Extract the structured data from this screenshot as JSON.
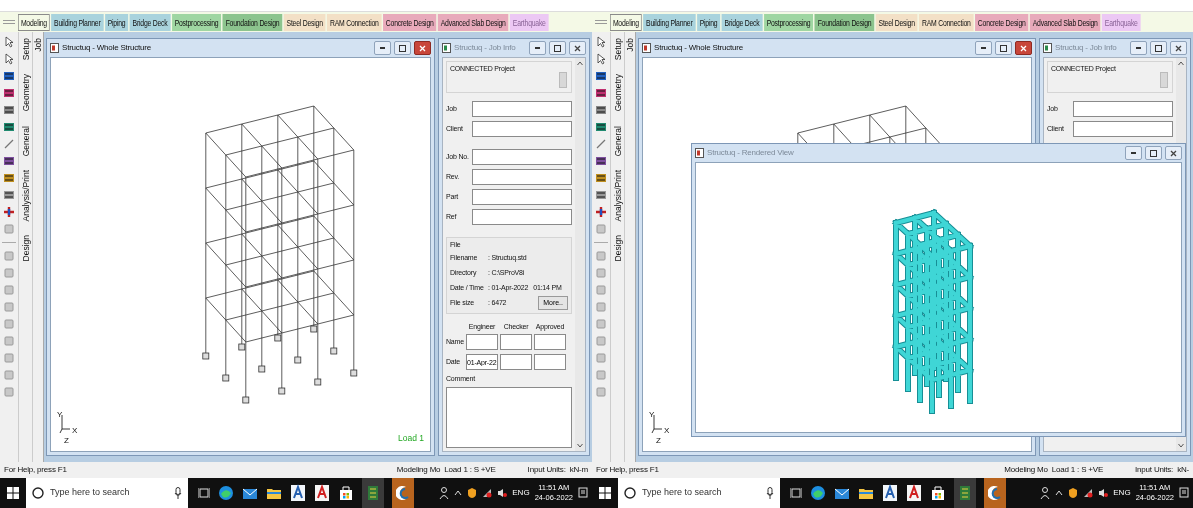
{
  "panes": [
    {
      "tabs": [
        {
          "label": "Modeling",
          "color": "#f4f9e6",
          "selected": true,
          "disabled": false
        },
        {
          "label": "Building Planner",
          "color": "#a9d3dd",
          "selected": false,
          "disabled": false
        },
        {
          "label": "Piping",
          "color": "#a9d3dd",
          "selected": false,
          "disabled": false
        },
        {
          "label": "Bridge Deck",
          "color": "#a9d3dd",
          "selected": false,
          "disabled": false
        },
        {
          "label": "Postprocessing",
          "color": "#9fd6a2",
          "selected": false,
          "disabled": false
        },
        {
          "label": "Foundation Design",
          "color": "#8cc48e",
          "selected": false,
          "disabled": false
        },
        {
          "label": "Steel Design",
          "color": "#f3e0c6",
          "selected": false,
          "disabled": false
        },
        {
          "label": "RAM Connection",
          "color": "#f3e0c6",
          "selected": false,
          "disabled": false
        },
        {
          "label": "Concrete Design",
          "color": "#e8aabb",
          "selected": false,
          "disabled": false
        },
        {
          "label": "Advanced Slab Design",
          "color": "#e8aabb",
          "selected": false,
          "disabled": false
        },
        {
          "label": "Earthquake",
          "color": "#ecc8f4",
          "selected": false,
          "disabled": true
        }
      ],
      "side_tabs": [
        "Setup",
        "Geometry",
        "General",
        "Analysis/Print",
        "Design"
      ],
      "job_tab": "Job",
      "structure_window": {
        "title": "Structuq - Whole Structure",
        "active": true,
        "load_label": "Load 1",
        "axes": [
          "Y",
          "X",
          "Z"
        ]
      },
      "job_info": {
        "title": "Structuq - Job Info",
        "active": false,
        "connected_label": "CONNECTED Project",
        "field_groups": [
          [
            {
              "label": "Job"
            },
            {
              "label": "Client"
            }
          ],
          [
            {
              "label": "Job No."
            },
            {
              "label": "Rev."
            },
            {
              "label": "Part"
            },
            {
              "label": "Ref"
            }
          ]
        ],
        "file": {
          "heading": "File",
          "rows": [
            {
              "label": "Filename",
              "value": ": Structuq.std"
            },
            {
              "label": "Directory",
              "value": ": C:\\SProV8i"
            },
            {
              "label": "Date / Time",
              "value": ": 01-Apr-2022",
              "extra": "01:14 PM"
            },
            {
              "label": "File size",
              "value": ": 6472"
            }
          ],
          "more_button": "More.."
        },
        "approvals": {
          "columns": [
            "Engineer",
            "Checker",
            "Approved"
          ],
          "rows": [
            {
              "label": "Name"
            },
            {
              "label": "Date",
              "values": [
                "01-Apr-22"
              ]
            }
          ]
        },
        "comment_label": "Comment"
      },
      "status_bar": {
        "help": "For Help, press F1",
        "mode": "Modeling Mo",
        "load": "Load 1 : S +VE",
        "units_label": "Input Units:",
        "units": "kN-m"
      },
      "taskbar": {
        "search_placeholder": "Type here to search",
        "language": "ENG",
        "time": "11:51 AM",
        "date": "24-06-2022"
      }
    },
    {
      "tabs": [
        {
          "label": "Modeling",
          "color": "#f4f9e6",
          "selected": true,
          "disabled": false
        },
        {
          "label": "Building Planner",
          "color": "#a9d3dd",
          "selected": false,
          "disabled": false
        },
        {
          "label": "Piping",
          "color": "#a9d3dd",
          "selected": false,
          "disabled": false
        },
        {
          "label": "Bridge Deck",
          "color": "#a9d3dd",
          "selected": false,
          "disabled": false
        },
        {
          "label": "Postprocessing",
          "color": "#9fd6a2",
          "selected": false,
          "disabled": false
        },
        {
          "label": "Foundation Design",
          "color": "#8cc48e",
          "selected": false,
          "disabled": false
        },
        {
          "label": "Steel Design",
          "color": "#f3e0c6",
          "selected": false,
          "disabled": false
        },
        {
          "label": "RAM Connection",
          "color": "#f3e0c6",
          "selected": false,
          "disabled": false
        },
        {
          "label": "Concrete Design",
          "color": "#e8aabb",
          "selected": false,
          "disabled": false
        },
        {
          "label": "Advanced Slab Design",
          "color": "#e8aabb",
          "selected": false,
          "disabled": false
        },
        {
          "label": "Earthquake",
          "color": "#ecc8f4",
          "selected": false,
          "disabled": true
        }
      ],
      "side_tabs": [
        "Setup",
        "Geometry",
        "General",
        "Analysis/Print",
        "Design"
      ],
      "job_tab": "Job",
      "structure_window": {
        "title": "Structuq - Whole Structure",
        "active": true,
        "axes": [
          "Y",
          "X",
          "Z"
        ]
      },
      "job_info": {
        "title": "Structuq - Job Info",
        "active": false,
        "connected_label": "CONNECTED Project",
        "field_groups": [
          [
            {
              "label": "Job"
            },
            {
              "label": "Client"
            }
          ]
        ]
      },
      "rendered_window": {
        "title": "Structuq - Rendered View",
        "active": false
      },
      "status_bar": {
        "help": "For Help, press F1",
        "mode": "Modeling Mo",
        "load": "Load 1 : S +VE",
        "units_label": "Input Units:",
        "units": "kN-"
      },
      "taskbar": {
        "search_placeholder": "Type here to search",
        "language": "ENG",
        "time": "11:51 AM",
        "date": "24-06-2022"
      }
    }
  ]
}
